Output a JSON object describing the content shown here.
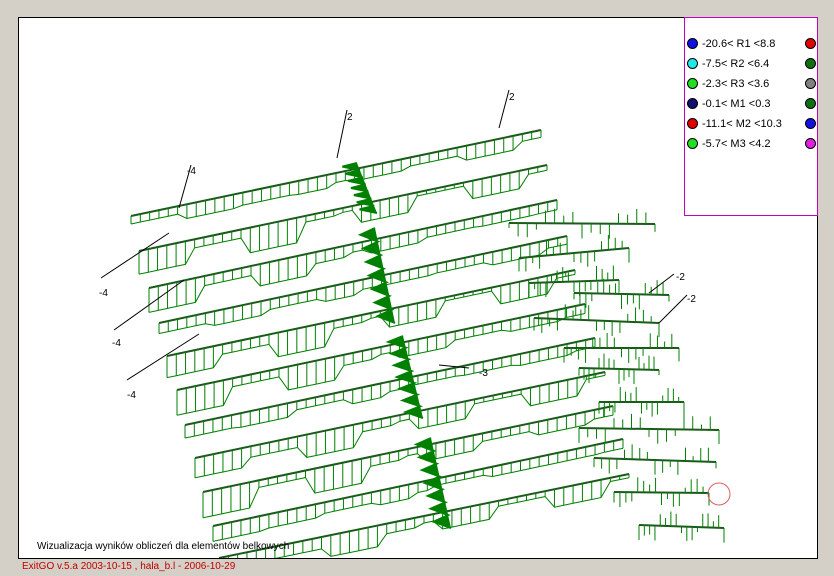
{
  "legend": {
    "items": [
      {
        "text": "-20.6< R1 <8.8",
        "color": "#1010e0",
        "right_color": "#e00000"
      },
      {
        "text": "-7.5< R2 <6.4",
        "color": "#20e8e8",
        "right_color": "#107010"
      },
      {
        "text": "-2.3< R3 <3.6",
        "color": "#20e020",
        "right_color": "#808080"
      },
      {
        "text": "-0.1< M1 <0.3",
        "color": "#101070",
        "right_color": "#107010"
      },
      {
        "text": "-11.1< M2 <10.3",
        "color": "#e00000",
        "right_color": "#1010e0"
      },
      {
        "text": "-5.7< M3 <4.2",
        "color": "#20e020",
        "right_color": "#e020e0"
      }
    ]
  },
  "caption": "Wizualizacja wyników obliczeń dla elementów belkowych",
  "footer": "ExitGO v.5.a 2003-10-15 , hala_b.l - 2006-10-29",
  "callouts": [
    "-4",
    "2",
    "2",
    "-4",
    "-4",
    "-4",
    "-2",
    "-2",
    "-3"
  ],
  "colors": {
    "diagram": "#008000",
    "axis": "#000000",
    "highlight_circle": "#e06060"
  }
}
